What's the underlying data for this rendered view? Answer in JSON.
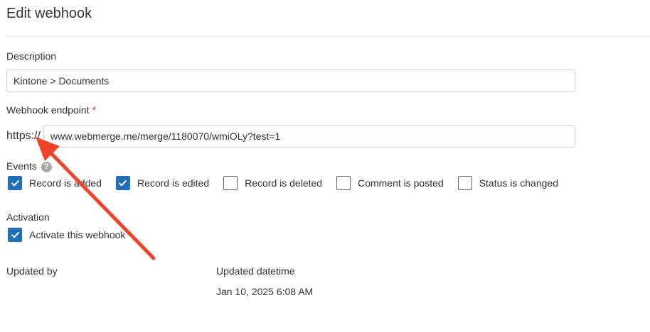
{
  "page": {
    "title": "Edit webhook"
  },
  "description": {
    "label": "Description",
    "value": "Kintone > Documents"
  },
  "endpoint": {
    "label": "Webhook endpoint",
    "required_mark": "*",
    "protocol": "https://",
    "value": "www.webmerge.me/merge/1180070/wmiOLy?test=1"
  },
  "events": {
    "label": "Events",
    "help_icon": "question-circle-icon",
    "help_glyph": "?",
    "items": [
      {
        "label": "Record is added",
        "checked": true
      },
      {
        "label": "Record is edited",
        "checked": true
      },
      {
        "label": "Record is deleted",
        "checked": false
      },
      {
        "label": "Comment is posted",
        "checked": false
      },
      {
        "label": "Status is changed",
        "checked": false
      }
    ]
  },
  "activation": {
    "label": "Activation",
    "checkbox_label": "Activate this webhook",
    "checked": true
  },
  "meta": {
    "updated_by_label": "Updated by",
    "updated_datetime_label": "Updated datetime",
    "updated_datetime_value": "Jan 10, 2025 6:08 AM"
  },
  "colors": {
    "accent": "#1f70b9",
    "required": "#e74c3c",
    "annotation_arrow": "#f0442a"
  }
}
